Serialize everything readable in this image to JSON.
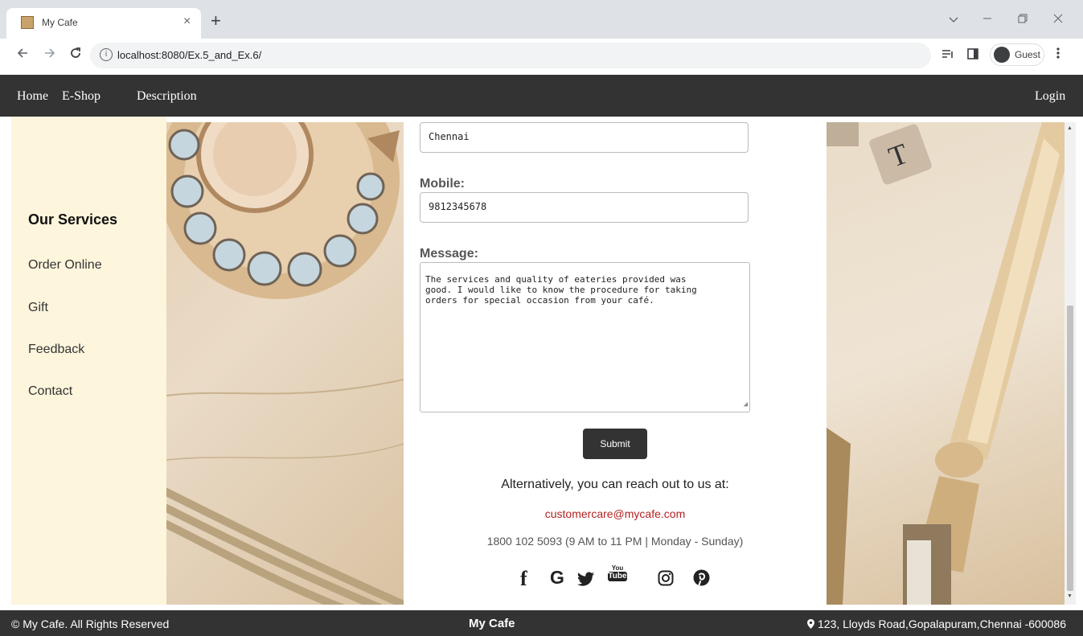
{
  "browser": {
    "tab_title": "My Cafe",
    "tab_close": "×",
    "new_tab": "+",
    "url": "localhost:8080/Ex.5_and_Ex.6/",
    "profile_label": "Guest"
  },
  "nav": {
    "home": "Home",
    "eshop": "E-Shop",
    "description": "Description",
    "login": "Login"
  },
  "sidebar": {
    "title": "Our Services",
    "items": [
      "Order Online",
      "Gift",
      "Feedback",
      "Contact"
    ]
  },
  "form": {
    "city_value": "Chennai",
    "mobile_label": "Mobile:",
    "mobile_value": "9812345678",
    "message_label": "Message:",
    "message_value": "The services and quality of eateries provided was\ngood. I would like to know the procedure for taking\norders for special occasion from your café.",
    "submit_label": "Submit"
  },
  "contact": {
    "alt_text": "Alternatively, you can reach out to us at:",
    "email": "customercare@mycafe.com",
    "phone": "1800 102 5093 (9 AM to 11 PM | Monday - Sunday)"
  },
  "social": {
    "facebook": "f",
    "google": "G",
    "youtube_top": "You",
    "youtube_bottom": "Tube"
  },
  "footer": {
    "copyright": "© My Cafe. All Rights Reserved",
    "brand": "My Cafe",
    "address": "123, Lloyds Road,Gopalapuram,Chennai -600086"
  },
  "colors": {
    "nav_bg": "#333333",
    "sidebar_bg": "#fdf5dc",
    "email_color": "#b22222"
  }
}
